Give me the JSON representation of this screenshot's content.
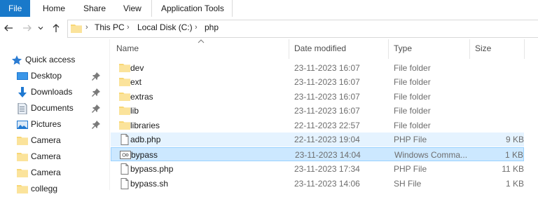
{
  "ribbon": {
    "tabs": [
      {
        "label": "File"
      },
      {
        "label": "Home"
      },
      {
        "label": "Share"
      },
      {
        "label": "View"
      },
      {
        "label": "Application Tools"
      }
    ]
  },
  "address": {
    "crumbs": [
      "This PC",
      "Local Disk (C:)",
      "php"
    ]
  },
  "sidebar": {
    "quick_access": "Quick access",
    "items": [
      {
        "label": "Desktop",
        "icon": "desktop-icon",
        "pinned": true
      },
      {
        "label": "Downloads",
        "icon": "downloads-icon",
        "pinned": true
      },
      {
        "label": "Documents",
        "icon": "documents-icon",
        "pinned": true
      },
      {
        "label": "Pictures",
        "icon": "pictures-icon",
        "pinned": true
      },
      {
        "label": "Camera",
        "icon": "folder-icon",
        "pinned": false
      },
      {
        "label": "Camera",
        "icon": "folder-icon",
        "pinned": false
      },
      {
        "label": "Camera",
        "icon": "folder-icon",
        "pinned": false
      },
      {
        "label": "collegg",
        "icon": "folder-icon",
        "pinned": false
      }
    ]
  },
  "columns": {
    "name": "Name",
    "date": "Date modified",
    "type": "Type",
    "size": "Size"
  },
  "files": [
    {
      "name": "dev",
      "date": "23-11-2023 16:07",
      "type": "File folder",
      "size": "",
      "icon": "folder-icon",
      "state": ""
    },
    {
      "name": "ext",
      "date": "23-11-2023 16:07",
      "type": "File folder",
      "size": "",
      "icon": "folder-icon",
      "state": ""
    },
    {
      "name": "extras",
      "date": "23-11-2023 16:07",
      "type": "File folder",
      "size": "",
      "icon": "folder-icon",
      "state": ""
    },
    {
      "name": "lib",
      "date": "23-11-2023 16:07",
      "type": "File folder",
      "size": "",
      "icon": "folder-icon",
      "state": ""
    },
    {
      "name": "libraries",
      "date": "22-11-2023 22:57",
      "type": "File folder",
      "size": "",
      "icon": "folder-icon",
      "state": ""
    },
    {
      "name": "adb.php",
      "date": "22-11-2023 19:04",
      "type": "PHP File",
      "size": "9 KB",
      "icon": "file-icon",
      "state": "hover"
    },
    {
      "name": "bypass",
      "date": "23-11-2023 14:04",
      "type": "Windows Comma...",
      "size": "1 KB",
      "icon": "batch-file-icon",
      "state": "selected"
    },
    {
      "name": "bypass.php",
      "date": "23-11-2023 17:34",
      "type": "PHP File",
      "size": "11 KB",
      "icon": "file-icon",
      "state": ""
    },
    {
      "name": "bypass.sh",
      "date": "23-11-2023 14:06",
      "type": "SH File",
      "size": "1 KB",
      "icon": "file-icon",
      "state": ""
    }
  ],
  "colors": {
    "file_tab": "#1979ca",
    "folder": "#f8d775",
    "selected_bg": "#cce8ff",
    "hover_bg": "#e5f3ff"
  }
}
